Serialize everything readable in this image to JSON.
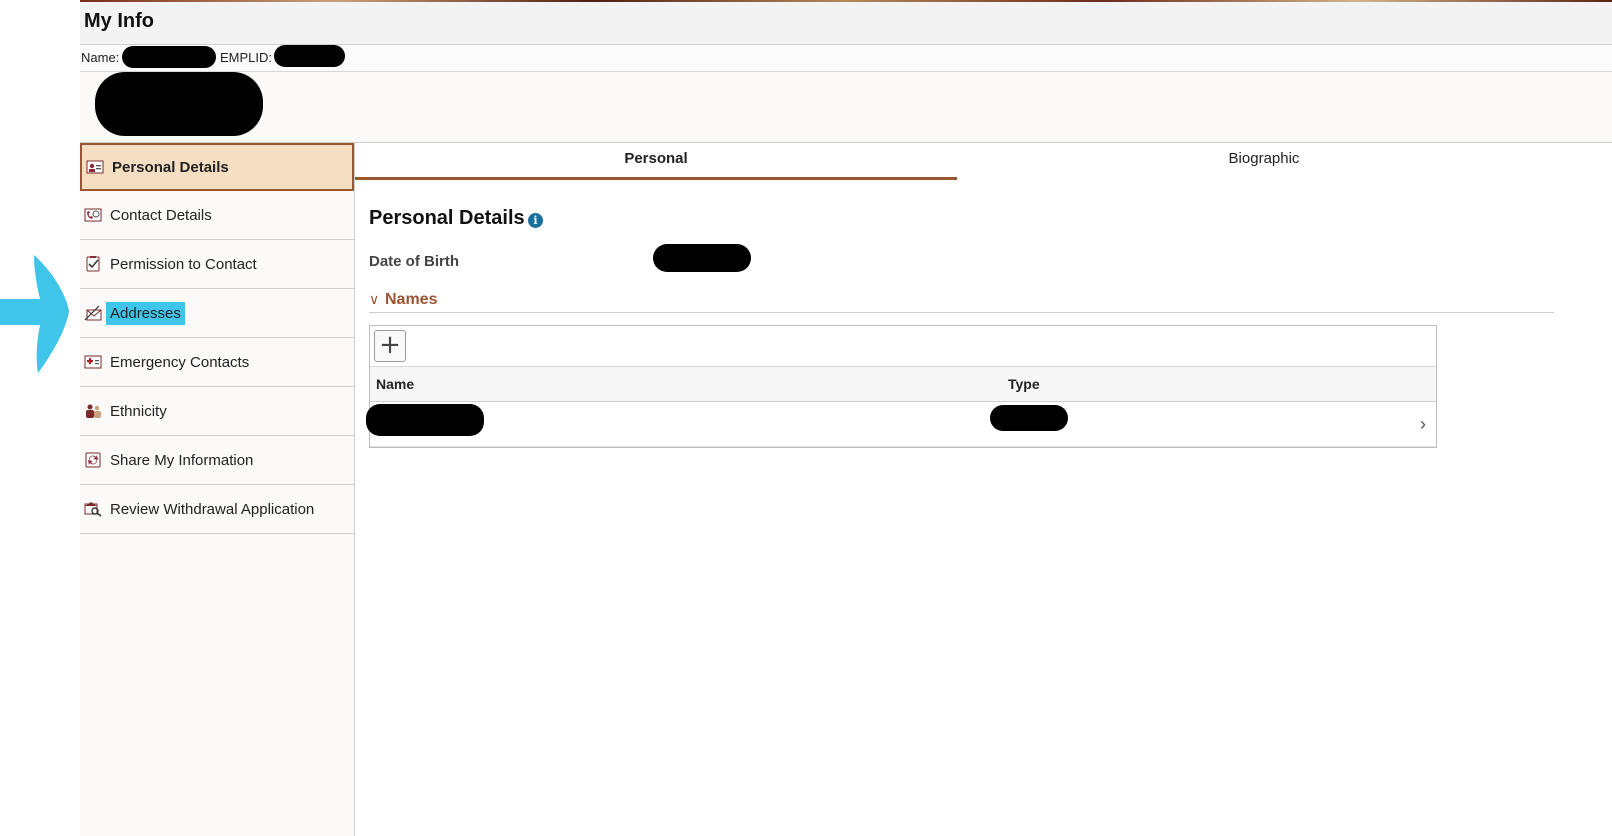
{
  "header": {
    "title": "My Info"
  },
  "idbar": {
    "name_label": "Name:",
    "emplid_label": "EMPLID:"
  },
  "sidebar": {
    "items": [
      {
        "label": "Personal Details",
        "icon": "personal-details-icon"
      },
      {
        "label": "Contact Details",
        "icon": "contact-details-icon"
      },
      {
        "label": "Permission to Contact",
        "icon": "permission-icon"
      },
      {
        "label": "Addresses",
        "icon": "addresses-icon"
      },
      {
        "label": "Emergency Contacts",
        "icon": "emergency-icon"
      },
      {
        "label": "Ethnicity",
        "icon": "ethnicity-icon"
      },
      {
        "label": "Share My Information",
        "icon": "share-icon"
      },
      {
        "label": "Review Withdrawal Application",
        "icon": "review-icon"
      }
    ],
    "active": "Personal Details",
    "highlighted": "Addresses"
  },
  "tabs": [
    {
      "label": "Personal"
    },
    {
      "label": "Biographic"
    }
  ],
  "main": {
    "title": "Personal Details",
    "dob_label": "Date of Birth",
    "names_section": "Names",
    "grid": {
      "add_symbol": "+",
      "columns": [
        "Name",
        "Type"
      ]
    }
  },
  "colors": {
    "accent": "#9c5533",
    "active_bg": "#f5dec1",
    "highlight": "#3fc4ea",
    "info": "#1b6f9c"
  }
}
